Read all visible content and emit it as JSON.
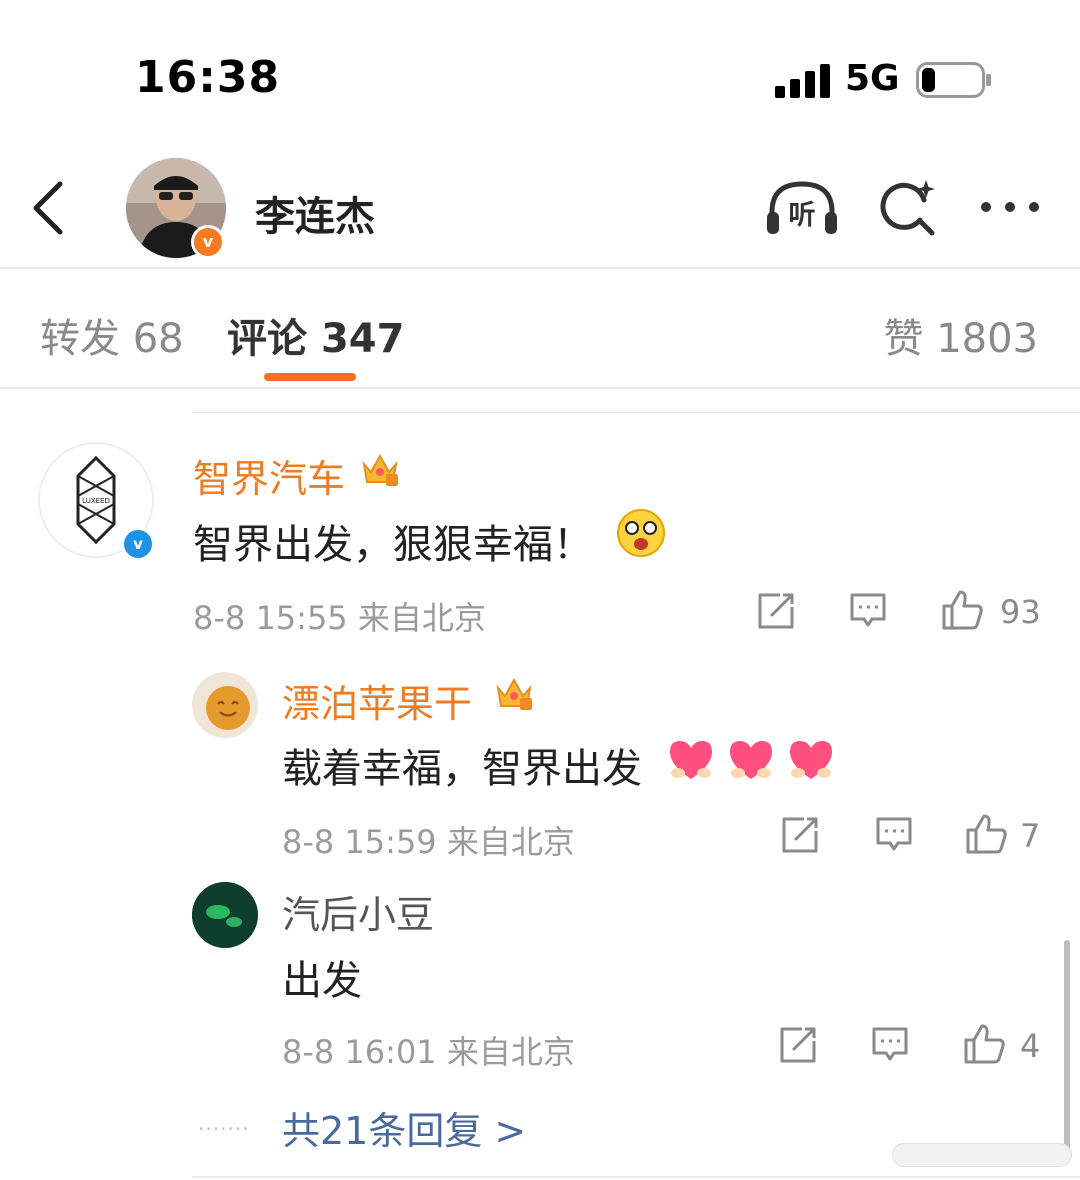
{
  "status_bar": {
    "time": "16:38",
    "network": "5G",
    "battery_level_percent": 20
  },
  "header": {
    "title": "李连杰",
    "verified_badge": "v",
    "listen_label": "听"
  },
  "tabs": {
    "repost": {
      "label": "转发",
      "count": "68"
    },
    "comment": {
      "label": "评论",
      "count": "347"
    },
    "like": {
      "label": "赞",
      "count": "1803"
    }
  },
  "comments": [
    {
      "user": "智界汽车",
      "verified_badge": "v",
      "avatar_logo": "LUXEED",
      "text": "智界出发，狠狠幸福！",
      "time": "8-8 15:55",
      "location": "来自北京",
      "likes": "93"
    }
  ],
  "replies": [
    {
      "user": "漂泊苹果干",
      "text": "载着幸福，智界出发",
      "time": "8-8 15:59",
      "location": "来自北京",
      "likes": "7"
    },
    {
      "user": "汽后小豆",
      "text": "出发",
      "time": "8-8 16:01",
      "location": "来自北京",
      "likes": "4"
    }
  ],
  "more_replies": "共21条回复 >",
  "colors": {
    "accent": "#f46f1e",
    "vip_name": "#f07c22",
    "link": "#4a6a9e",
    "verified_blue": "#1e92e6"
  },
  "icons": [
    "back-icon",
    "headphones-icon",
    "search-sparkle-icon",
    "more-icon",
    "share-icon",
    "comment-icon",
    "like-icon",
    "crown-icon"
  ]
}
